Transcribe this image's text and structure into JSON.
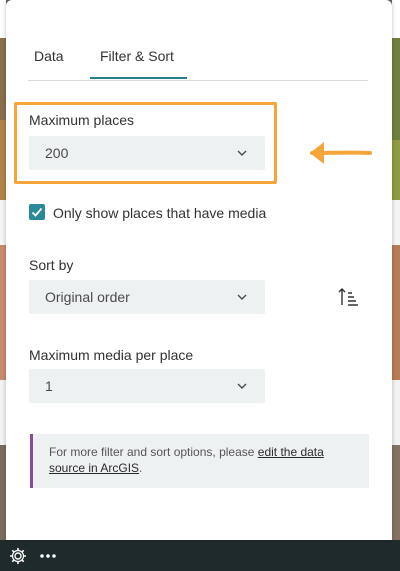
{
  "tabs": [
    {
      "label": "Data"
    },
    {
      "label": "Filter & Sort"
    }
  ],
  "active_tab": "Filter & Sort",
  "max_places": {
    "label": "Maximum places",
    "value": "200"
  },
  "media_filter": {
    "label": "Only show places that have media",
    "checked": true
  },
  "sort": {
    "label": "Sort by",
    "value": "Original order",
    "icon": "sort-ascending-icon"
  },
  "max_media": {
    "label": "Maximum media per place",
    "value": "1"
  },
  "info": {
    "text": "For more filter and sort options, please ",
    "link": "edit the data source in ArcGIS",
    "suffix": "."
  },
  "footer": {
    "icons": [
      "gear-icon",
      "more-options-icon"
    ]
  },
  "colors": {
    "accent": "#2a7d8a",
    "highlight": "#f5a53a",
    "info_bar": "#8a4a9a"
  }
}
